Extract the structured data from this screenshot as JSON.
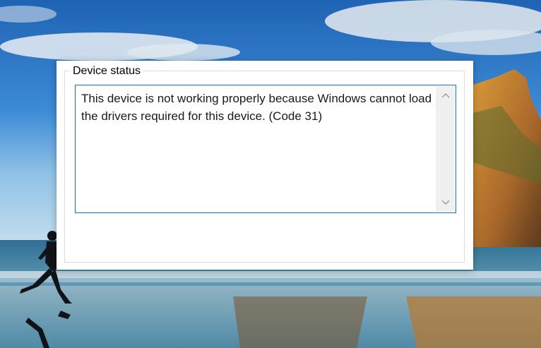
{
  "group": {
    "title": "Device status"
  },
  "status": {
    "message": "This device is not working properly because Windows cannot load the drivers required for this device. (Code 31)"
  },
  "icons": {
    "scroll_up": "chevron-up-icon",
    "scroll_down": "chevron-down-icon"
  },
  "colors": {
    "focus_border": "#0b74d6",
    "scrollbar_track": "#f0f0f0",
    "groupbox_border": "#dcdcdc"
  }
}
